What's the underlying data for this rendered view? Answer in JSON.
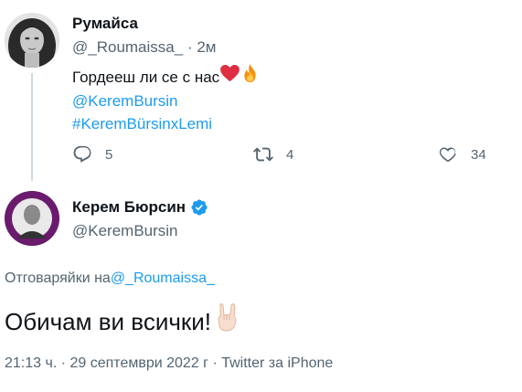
{
  "parent_tweet": {
    "name": "Румайса",
    "handle": "@_Roumaissa_",
    "time": "· 2м",
    "text": "Гордееш ли се с нас",
    "mention": "@KeremBursin",
    "hashtag": "#KeremBürsinxLemi",
    "reply_count": "5",
    "retweet_count": "4",
    "like_count": "34"
  },
  "main_tweet": {
    "name": "Керем Бюрсин",
    "handle": "@KeremBursin",
    "replying_prefix": "Отговаряйки на",
    "replying_to": "@_Roumaissa_",
    "text": "Обичам ви всички!",
    "time": "21:13 ч.",
    "date": "29 септември 2022 г",
    "source": "Twitter за iPhone"
  },
  "icons": {
    "reply": "reply-icon",
    "retweet": "retweet-icon",
    "like": "heart-icon",
    "verified": "verified-badge-icon",
    "heart_emoji": "red-heart-emoji",
    "fire_emoji": "fire-emoji",
    "rock_emoji": "rock-hand-emoji"
  },
  "colors": {
    "link": "#1d9bf0",
    "secondary": "#536471",
    "verified": "#1d9bf0"
  }
}
